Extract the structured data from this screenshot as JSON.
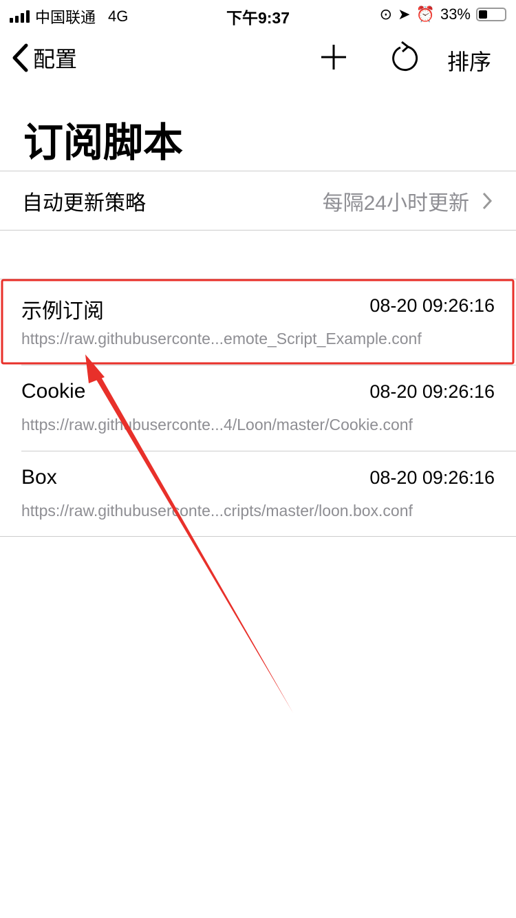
{
  "status_bar": {
    "carrier": "中国联通",
    "network": "4G",
    "time": "下午9:37",
    "battery": "33%",
    "battery_level": 0.33
  },
  "nav": {
    "back_label": "配置",
    "sort_label": "排序"
  },
  "title": "订阅脚本",
  "policy": {
    "label": "自动更新策略",
    "value": "每隔24小时更新"
  },
  "subscriptions": [
    {
      "name": "示例订阅",
      "time": "08-20 09:26:16",
      "url": "https://raw.githubuserconte...emote_Script_Example.conf"
    },
    {
      "name": "Cookie",
      "time": "08-20 09:26:16",
      "url": "https://raw.githubuserconte...4/Loon/master/Cookie.conf"
    },
    {
      "name": "Box",
      "time": "08-20 09:26:16",
      "url": "https://raw.githubuserconte...cripts/master/loon.box.conf"
    }
  ],
  "colors": {
    "annotation": "#e8302a",
    "secondary_text": "#8e8e93"
  }
}
